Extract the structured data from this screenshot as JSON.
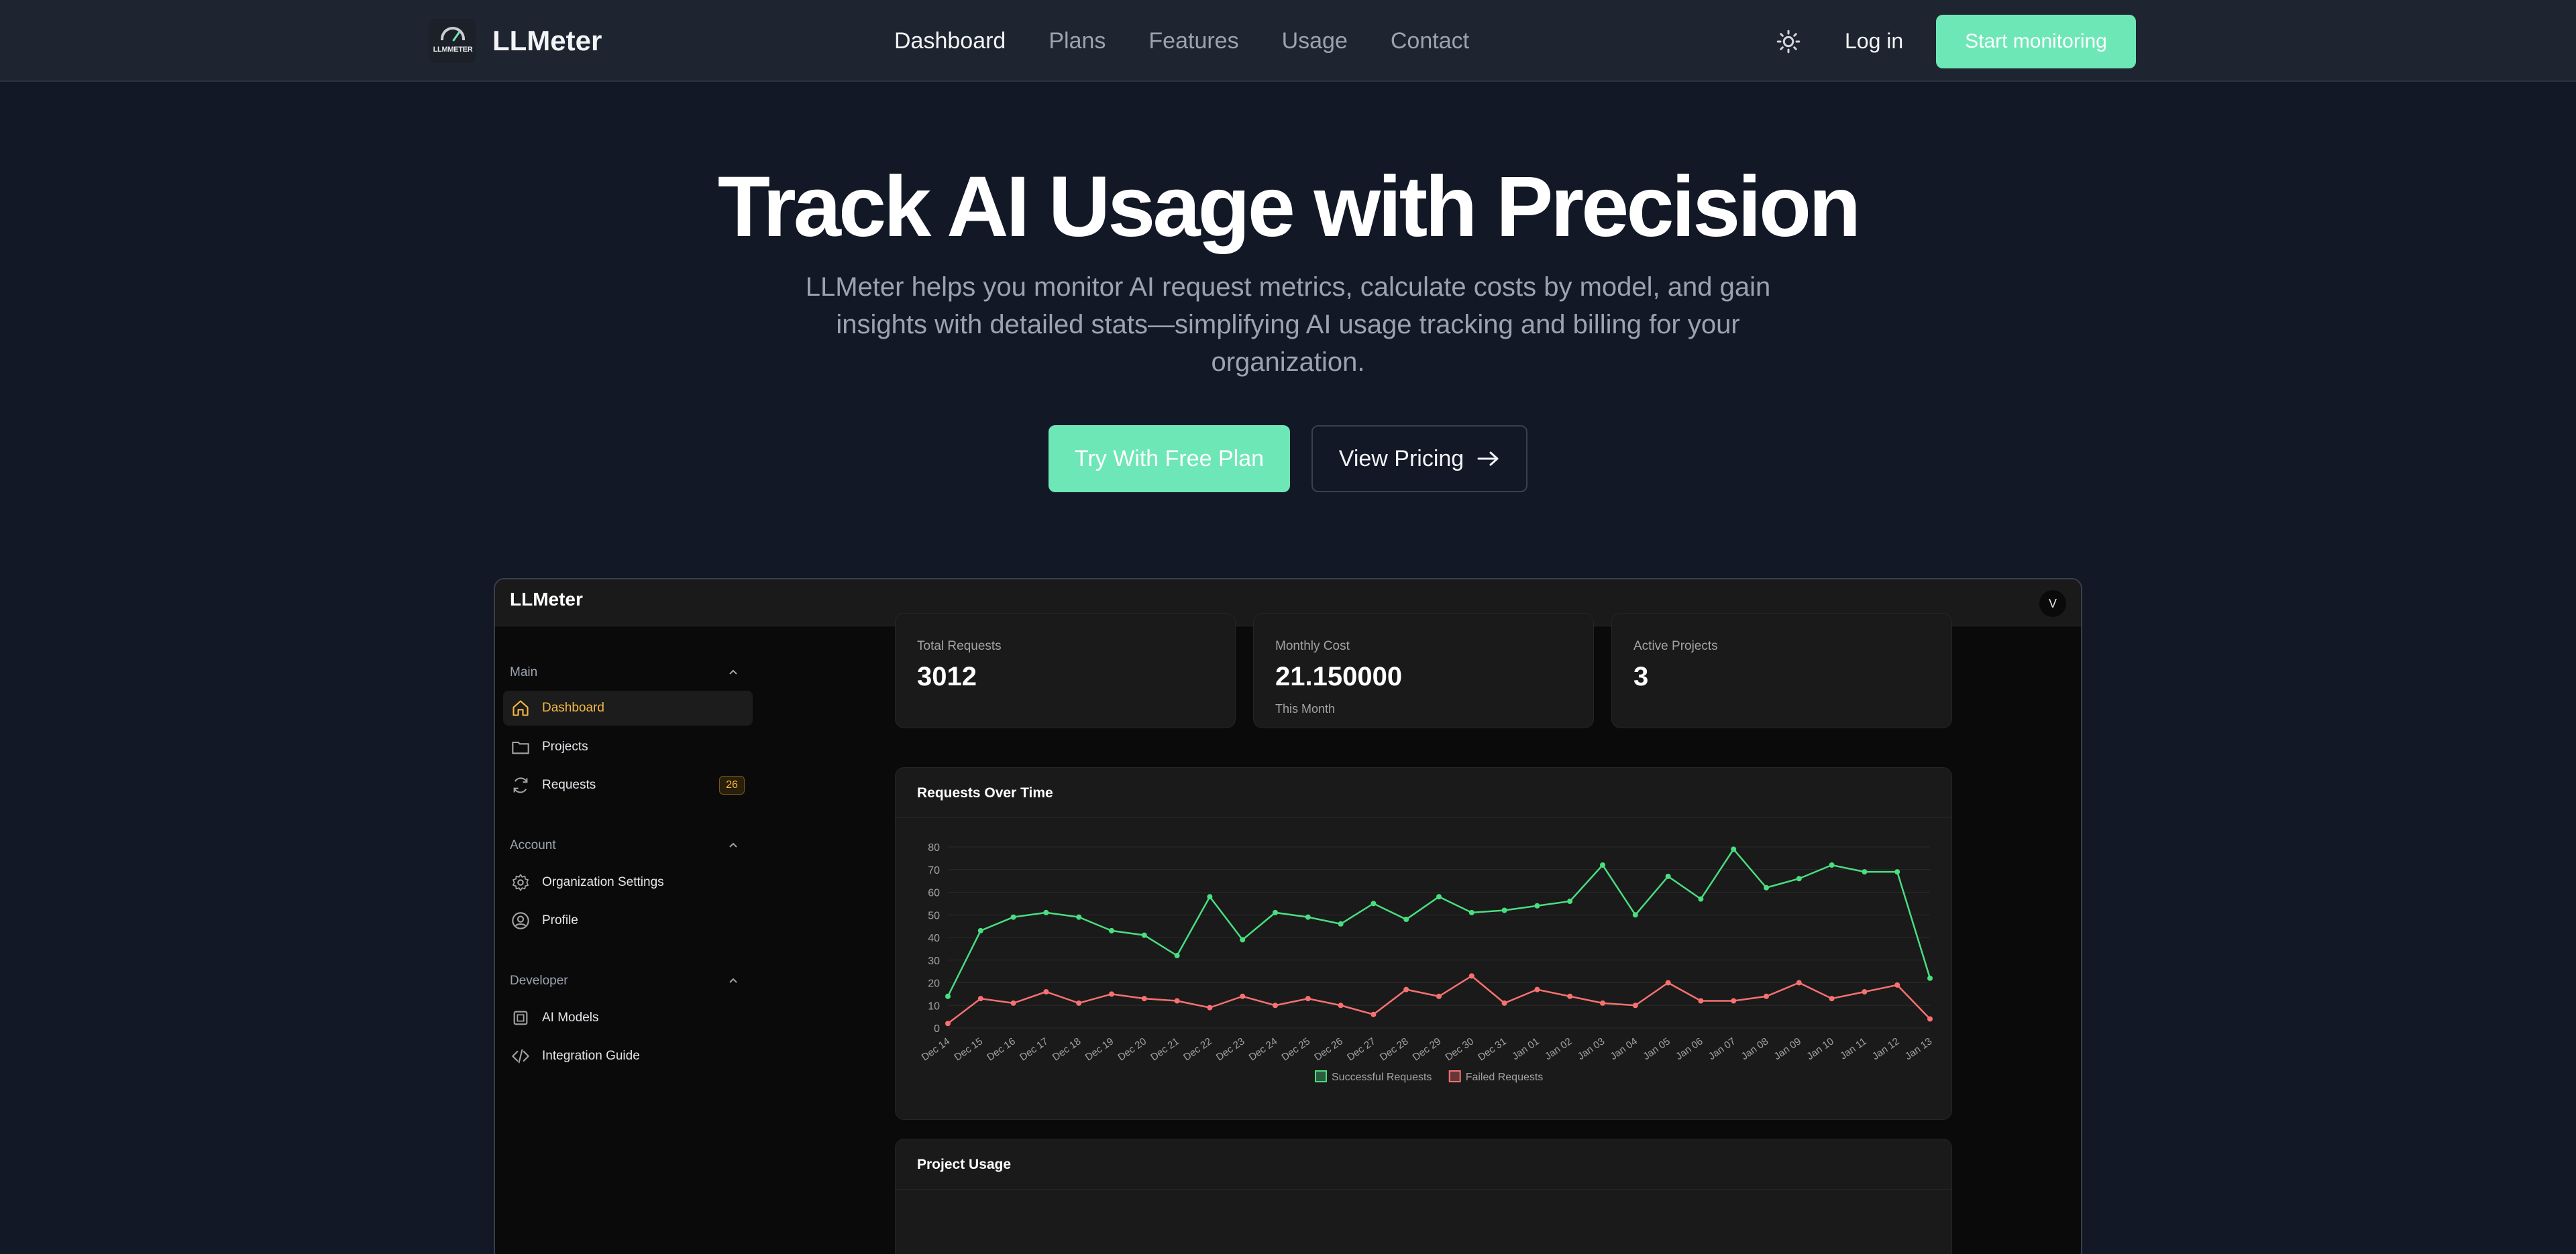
{
  "nav": {
    "brand": "LLMeter",
    "logo_text": "LLMMETER",
    "links": [
      "Dashboard",
      "Plans",
      "Features",
      "Usage",
      "Contact"
    ],
    "active": "Dashboard",
    "theme_icon": "sun-icon",
    "login": "Log in",
    "cta": "Start monitoring"
  },
  "hero": {
    "title": "Track AI Usage with Precision",
    "subtitle": "LLMeter helps you monitor AI request metrics, calculate costs by model, and gain insights with detailed stats—simplifying AI usage tracking and billing for your organization.",
    "primary_button": "Try With Free Plan",
    "secondary_button": "View Pricing"
  },
  "app": {
    "brand": "LLMeter",
    "avatar": "V",
    "sidebar": {
      "sections": [
        {
          "label": "Main",
          "items": [
            {
              "label": "Dashboard",
              "icon": "home-icon",
              "active": true
            },
            {
              "label": "Projects",
              "icon": "folder-icon"
            },
            {
              "label": "Requests",
              "icon": "refresh-icon",
              "badge": "26"
            }
          ]
        },
        {
          "label": "Account",
          "items": [
            {
              "label": "Organization Settings",
              "icon": "gear-icon"
            },
            {
              "label": "Profile",
              "icon": "user-circle-icon"
            }
          ]
        },
        {
          "label": "Developer",
          "items": [
            {
              "label": "AI Models",
              "icon": "cpu-icon"
            },
            {
              "label": "Integration Guide",
              "icon": "code-icon"
            }
          ]
        }
      ]
    },
    "stats": [
      {
        "label": "Total Requests",
        "value": "3012",
        "note": ""
      },
      {
        "label": "Monthly Cost",
        "value": "21.150000",
        "note": "This Month"
      },
      {
        "label": "Active Projects",
        "value": "3",
        "note": ""
      }
    ],
    "requests_card_title": "Requests Over Time",
    "project_usage_title": "Project Usage"
  },
  "colors": {
    "accent": "#6ee7b7",
    "success": "#4ade80",
    "failed": "#f87171",
    "active_nav": "#f5b942"
  },
  "chart_data": {
    "type": "line",
    "title": "Requests Over Time",
    "x": [
      "Dec 14",
      "Dec 15",
      "Dec 16",
      "Dec 17",
      "Dec 18",
      "Dec 19",
      "Dec 20",
      "Dec 21",
      "Dec 22",
      "Dec 23",
      "Dec 24",
      "Dec 25",
      "Dec 26",
      "Dec 27",
      "Dec 28",
      "Dec 29",
      "Dec 30",
      "Dec 31",
      "Jan 01",
      "Jan 02",
      "Jan 03",
      "Jan 04",
      "Jan 05",
      "Jan 06",
      "Jan 07",
      "Jan 08",
      "Jan 09",
      "Jan 10",
      "Jan 11",
      "Jan 12",
      "Jan 13"
    ],
    "series": [
      {
        "name": "Successful Requests",
        "color": "#4ade80",
        "values": [
          14,
          43,
          49,
          51,
          49,
          43,
          41,
          32,
          58,
          39,
          51,
          49,
          46,
          55,
          48,
          58,
          51,
          52,
          54,
          56,
          72,
          50,
          67,
          57,
          79,
          62,
          66,
          72,
          69,
          69,
          22
        ]
      },
      {
        "name": "Failed Requests",
        "color": "#f87171",
        "values": [
          2,
          13,
          11,
          16,
          11,
          15,
          13,
          12,
          9,
          14,
          10,
          13,
          10,
          6,
          17,
          14,
          23,
          11,
          17,
          14,
          11,
          10,
          20,
          12,
          12,
          14,
          20,
          13,
          16,
          19,
          4
        ]
      }
    ],
    "yticks": [
      0,
      10,
      20,
      30,
      40,
      50,
      60,
      70,
      80
    ],
    "ylim": [
      0,
      80
    ],
    "grid": true,
    "legend": "bottom"
  }
}
